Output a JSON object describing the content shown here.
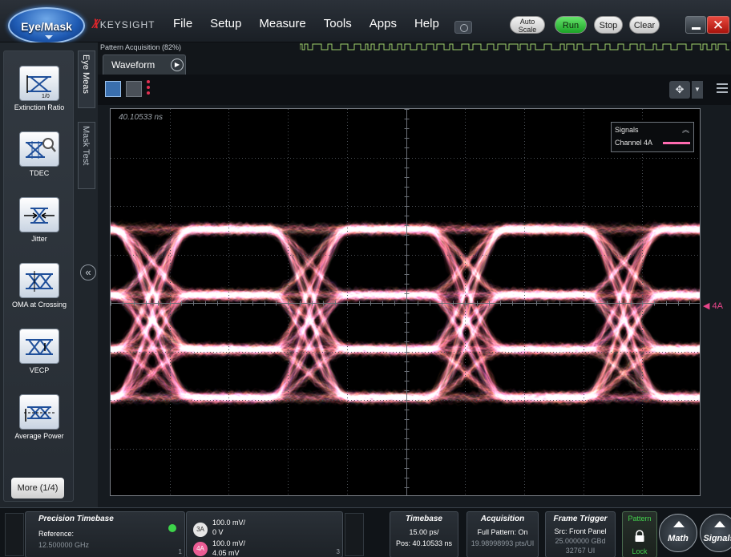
{
  "mode_button": {
    "label": "Eye/Mask"
  },
  "brand": {
    "name": "KEYSIGHT"
  },
  "menu": [
    "File",
    "Setup",
    "Measure",
    "Tools",
    "Apps",
    "Help"
  ],
  "toolbar": {
    "autoscale_line1": "Auto",
    "autoscale_line2": "Scale",
    "run": "Run",
    "stop": "Stop",
    "clear": "Clear"
  },
  "acquisition_strip": {
    "label": "Pattern Acquisition   (82%)",
    "progress": 0.82
  },
  "side_tabs": {
    "eye_meas": "Eye Meas",
    "mask_test": "Mask Test"
  },
  "measurements": [
    {
      "label": "Extinction Ratio",
      "icon": "extinction-ratio-icon"
    },
    {
      "label": "TDEC",
      "icon": "tdec-icon"
    },
    {
      "label": "Jitter",
      "icon": "jitter-icon"
    },
    {
      "label": "OMA at Crossing",
      "icon": "oma-icon"
    },
    {
      "label": "VECP",
      "icon": "vecp-icon"
    },
    {
      "label": "Average Power",
      "icon": "average-power-icon"
    }
  ],
  "more_button": "More (1/4)",
  "waveform_tab": {
    "label": "Waveform"
  },
  "scope": {
    "time_label": "40.10533 ns",
    "legend_title": "Signals",
    "legend_channel": "Channel 4A",
    "channel_marker": "4A",
    "channel_color": "#ff6bb0"
  },
  "bottom": {
    "precision_timebase": {
      "title": "Precision Timebase",
      "ref_label": "Reference:",
      "ref_value": "12.500000 GHz",
      "status_color": "#3dd44a"
    },
    "channels": [
      {
        "badge": "3A",
        "line1": "100.0 mV/",
        "line2": "0 V"
      },
      {
        "badge": "4A",
        "line1": "100.0 mV/",
        "line2": "4.05 mV"
      }
    ],
    "channel_numbers": [
      "1",
      "3"
    ],
    "timebase": {
      "title": "Timebase",
      "line1": "15.00 ps/",
      "line2": "Pos: 40.10533 ns"
    },
    "acquisition": {
      "title": "Acquisition",
      "line1": "Full Pattern: On",
      "line2": "19.98998993 pts/UI"
    },
    "frame_trigger": {
      "title": "Frame Trigger",
      "line1": "Src: Front Panel",
      "line2": "25.000000 GBd",
      "line3": "32767 UI"
    },
    "pattern": {
      "title": "Pattern",
      "lock": "Lock"
    },
    "math": "Math",
    "signals": "Signals"
  }
}
